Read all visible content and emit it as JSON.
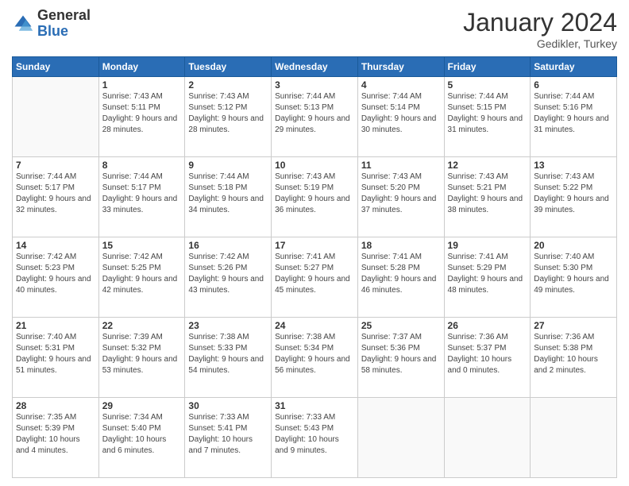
{
  "header": {
    "logo_general": "General",
    "logo_blue": "Blue",
    "month_year": "January 2024",
    "location": "Gedikler, Turkey"
  },
  "weekdays": [
    "Sunday",
    "Monday",
    "Tuesday",
    "Wednesday",
    "Thursday",
    "Friday",
    "Saturday"
  ],
  "weeks": [
    [
      {
        "day": "",
        "sunrise": "",
        "sunset": "",
        "daylight": ""
      },
      {
        "day": "1",
        "sunrise": "Sunrise: 7:43 AM",
        "sunset": "Sunset: 5:11 PM",
        "daylight": "Daylight: 9 hours and 28 minutes."
      },
      {
        "day": "2",
        "sunrise": "Sunrise: 7:43 AM",
        "sunset": "Sunset: 5:12 PM",
        "daylight": "Daylight: 9 hours and 28 minutes."
      },
      {
        "day": "3",
        "sunrise": "Sunrise: 7:44 AM",
        "sunset": "Sunset: 5:13 PM",
        "daylight": "Daylight: 9 hours and 29 minutes."
      },
      {
        "day": "4",
        "sunrise": "Sunrise: 7:44 AM",
        "sunset": "Sunset: 5:14 PM",
        "daylight": "Daylight: 9 hours and 30 minutes."
      },
      {
        "day": "5",
        "sunrise": "Sunrise: 7:44 AM",
        "sunset": "Sunset: 5:15 PM",
        "daylight": "Daylight: 9 hours and 31 minutes."
      },
      {
        "day": "6",
        "sunrise": "Sunrise: 7:44 AM",
        "sunset": "Sunset: 5:16 PM",
        "daylight": "Daylight: 9 hours and 31 minutes."
      }
    ],
    [
      {
        "day": "7",
        "sunrise": "Sunrise: 7:44 AM",
        "sunset": "Sunset: 5:17 PM",
        "daylight": "Daylight: 9 hours and 32 minutes."
      },
      {
        "day": "8",
        "sunrise": "Sunrise: 7:44 AM",
        "sunset": "Sunset: 5:17 PM",
        "daylight": "Daylight: 9 hours and 33 minutes."
      },
      {
        "day": "9",
        "sunrise": "Sunrise: 7:44 AM",
        "sunset": "Sunset: 5:18 PM",
        "daylight": "Daylight: 9 hours and 34 minutes."
      },
      {
        "day": "10",
        "sunrise": "Sunrise: 7:43 AM",
        "sunset": "Sunset: 5:19 PM",
        "daylight": "Daylight: 9 hours and 36 minutes."
      },
      {
        "day": "11",
        "sunrise": "Sunrise: 7:43 AM",
        "sunset": "Sunset: 5:20 PM",
        "daylight": "Daylight: 9 hours and 37 minutes."
      },
      {
        "day": "12",
        "sunrise": "Sunrise: 7:43 AM",
        "sunset": "Sunset: 5:21 PM",
        "daylight": "Daylight: 9 hours and 38 minutes."
      },
      {
        "day": "13",
        "sunrise": "Sunrise: 7:43 AM",
        "sunset": "Sunset: 5:22 PM",
        "daylight": "Daylight: 9 hours and 39 minutes."
      }
    ],
    [
      {
        "day": "14",
        "sunrise": "Sunrise: 7:42 AM",
        "sunset": "Sunset: 5:23 PM",
        "daylight": "Daylight: 9 hours and 40 minutes."
      },
      {
        "day": "15",
        "sunrise": "Sunrise: 7:42 AM",
        "sunset": "Sunset: 5:25 PM",
        "daylight": "Daylight: 9 hours and 42 minutes."
      },
      {
        "day": "16",
        "sunrise": "Sunrise: 7:42 AM",
        "sunset": "Sunset: 5:26 PM",
        "daylight": "Daylight: 9 hours and 43 minutes."
      },
      {
        "day": "17",
        "sunrise": "Sunrise: 7:41 AM",
        "sunset": "Sunset: 5:27 PM",
        "daylight": "Daylight: 9 hours and 45 minutes."
      },
      {
        "day": "18",
        "sunrise": "Sunrise: 7:41 AM",
        "sunset": "Sunset: 5:28 PM",
        "daylight": "Daylight: 9 hours and 46 minutes."
      },
      {
        "day": "19",
        "sunrise": "Sunrise: 7:41 AM",
        "sunset": "Sunset: 5:29 PM",
        "daylight": "Daylight: 9 hours and 48 minutes."
      },
      {
        "day": "20",
        "sunrise": "Sunrise: 7:40 AM",
        "sunset": "Sunset: 5:30 PM",
        "daylight": "Daylight: 9 hours and 49 minutes."
      }
    ],
    [
      {
        "day": "21",
        "sunrise": "Sunrise: 7:40 AM",
        "sunset": "Sunset: 5:31 PM",
        "daylight": "Daylight: 9 hours and 51 minutes."
      },
      {
        "day": "22",
        "sunrise": "Sunrise: 7:39 AM",
        "sunset": "Sunset: 5:32 PM",
        "daylight": "Daylight: 9 hours and 53 minutes."
      },
      {
        "day": "23",
        "sunrise": "Sunrise: 7:38 AM",
        "sunset": "Sunset: 5:33 PM",
        "daylight": "Daylight: 9 hours and 54 minutes."
      },
      {
        "day": "24",
        "sunrise": "Sunrise: 7:38 AM",
        "sunset": "Sunset: 5:34 PM",
        "daylight": "Daylight: 9 hours and 56 minutes."
      },
      {
        "day": "25",
        "sunrise": "Sunrise: 7:37 AM",
        "sunset": "Sunset: 5:36 PM",
        "daylight": "Daylight: 9 hours and 58 minutes."
      },
      {
        "day": "26",
        "sunrise": "Sunrise: 7:36 AM",
        "sunset": "Sunset: 5:37 PM",
        "daylight": "Daylight: 10 hours and 0 minutes."
      },
      {
        "day": "27",
        "sunrise": "Sunrise: 7:36 AM",
        "sunset": "Sunset: 5:38 PM",
        "daylight": "Daylight: 10 hours and 2 minutes."
      }
    ],
    [
      {
        "day": "28",
        "sunrise": "Sunrise: 7:35 AM",
        "sunset": "Sunset: 5:39 PM",
        "daylight": "Daylight: 10 hours and 4 minutes."
      },
      {
        "day": "29",
        "sunrise": "Sunrise: 7:34 AM",
        "sunset": "Sunset: 5:40 PM",
        "daylight": "Daylight: 10 hours and 6 minutes."
      },
      {
        "day": "30",
        "sunrise": "Sunrise: 7:33 AM",
        "sunset": "Sunset: 5:41 PM",
        "daylight": "Daylight: 10 hours and 7 minutes."
      },
      {
        "day": "31",
        "sunrise": "Sunrise: 7:33 AM",
        "sunset": "Sunset: 5:43 PM",
        "daylight": "Daylight: 10 hours and 9 minutes."
      },
      {
        "day": "",
        "sunrise": "",
        "sunset": "",
        "daylight": ""
      },
      {
        "day": "",
        "sunrise": "",
        "sunset": "",
        "daylight": ""
      },
      {
        "day": "",
        "sunrise": "",
        "sunset": "",
        "daylight": ""
      }
    ]
  ]
}
